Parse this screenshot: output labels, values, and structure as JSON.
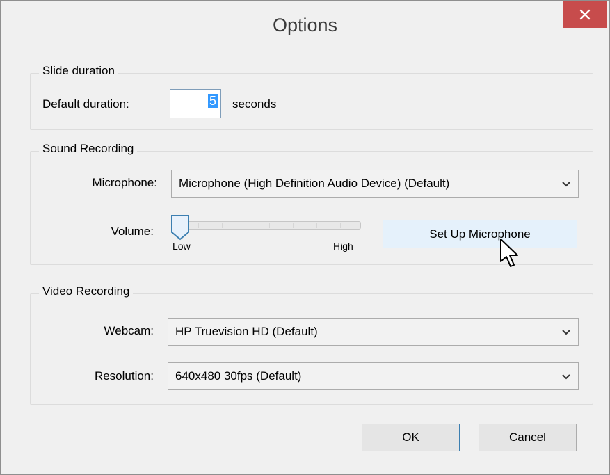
{
  "window": {
    "title": "Options",
    "close_icon": "close-icon",
    "close_color": "#c74c4c"
  },
  "slide_duration": {
    "legend": "Slide duration",
    "default_duration_label": "Default duration:",
    "default_duration_value": "5",
    "unit": "seconds"
  },
  "sound_recording": {
    "legend": "Sound Recording",
    "microphone_label": "Microphone:",
    "microphone_value": "Microphone (High Definition Audio Device) (Default)",
    "volume_label": "Volume:",
    "volume_low": "Low",
    "volume_high": "High",
    "volume_level_fraction": 0.0,
    "setup_button": "Set Up Microphone"
  },
  "video_recording": {
    "legend": "Video Recording",
    "webcam_label": "Webcam:",
    "webcam_value": "HP Truevision HD (Default)",
    "resolution_label": "Resolution:",
    "resolution_value": "640x480 30fps (Default)"
  },
  "buttons": {
    "ok": "OK",
    "cancel": "Cancel"
  },
  "colors": {
    "accent": "#3399ff",
    "button_hover": "#e5f1fb"
  }
}
